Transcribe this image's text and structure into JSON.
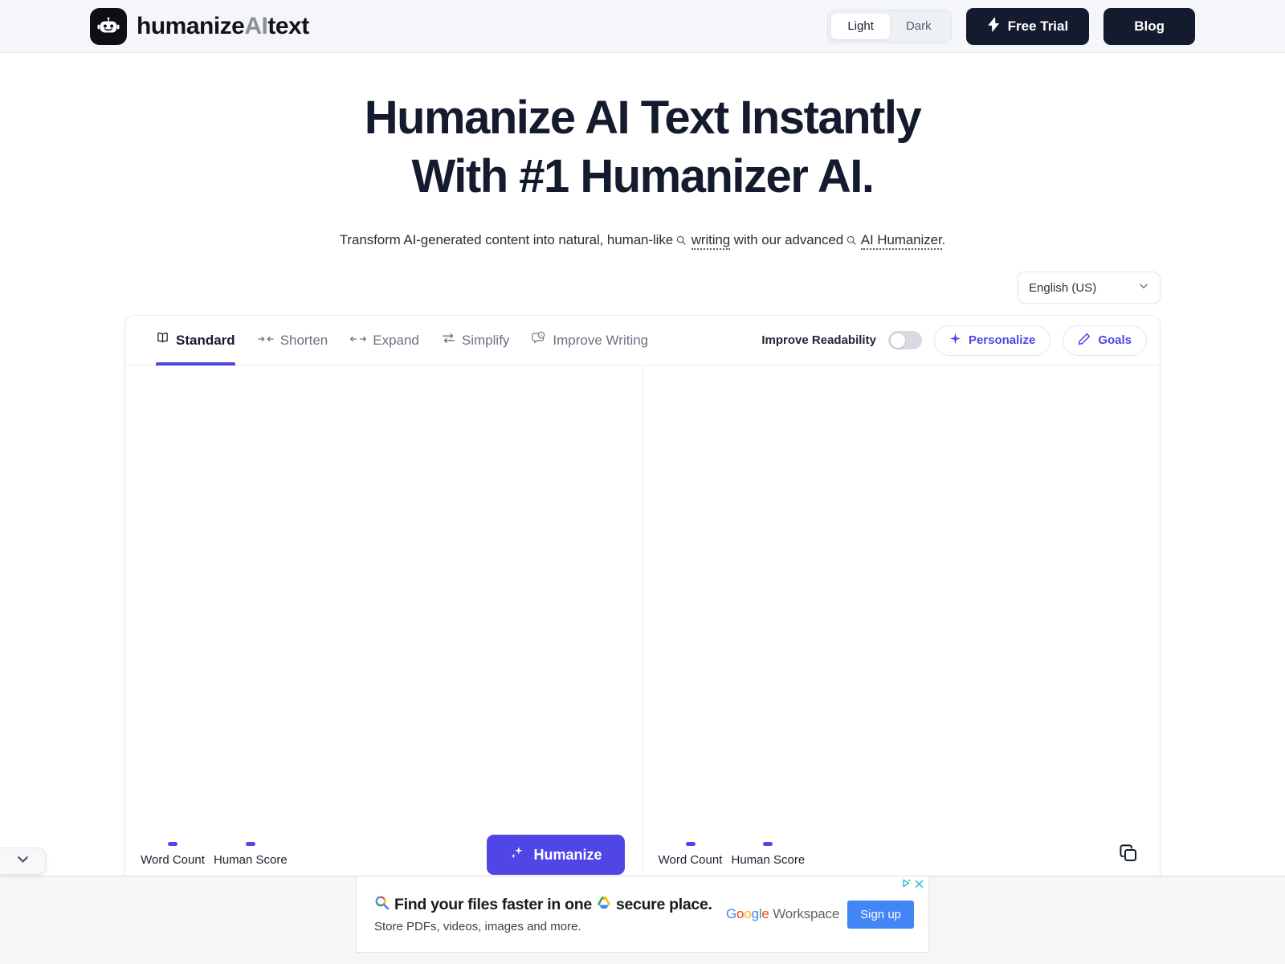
{
  "header": {
    "logo_icon": "robot-icon",
    "brand_part1": "humanize",
    "brand_part2": "AI",
    "brand_part3": "text",
    "theme": {
      "light": "Light",
      "dark": "Dark",
      "active": "Light"
    },
    "free_trial_label": "Free Trial",
    "free_trial_icon": "lightning-bolt-icon",
    "blog_label": "Blog"
  },
  "hero": {
    "title_line1": "Humanize AI Text Instantly",
    "title_line2": "With #1 Humanizer AI.",
    "sub_part1": "Transform AI-generated content into natural, human-like",
    "sub_kw1": "writing",
    "sub_part2": "with our advanced",
    "sub_kw2": "AI Humanizer",
    "sub_part3": "."
  },
  "language": {
    "selected": "English (US)",
    "chevron_icon": "chevron-down-icon"
  },
  "toolbar": {
    "tabs": [
      {
        "label": "Standard",
        "icon": "book-icon",
        "active": true
      },
      {
        "label": "Shorten",
        "icon": "arrows-in-icon",
        "active": false
      },
      {
        "label": "Expand",
        "icon": "arrows-out-icon",
        "active": false
      },
      {
        "label": "Simplify",
        "icon": "swap-vertical-icon",
        "active": false
      },
      {
        "label": "Improve Writing",
        "icon": "speech-bubble-a-icon",
        "active": false
      }
    ],
    "readability_label": "Improve Readability",
    "readability_on": false,
    "personalize_label": "Personalize",
    "personalize_icon": "sparkle-icon",
    "goals_label": "Goals",
    "goals_icon": "pencil-icon"
  },
  "editor": {
    "input_placeholder": "",
    "output_placeholder": "",
    "left_stats": [
      {
        "label": "Word Count",
        "value": "-"
      },
      {
        "label": "Human Score",
        "value": "-"
      }
    ],
    "right_stats": [
      {
        "label": "Word Count",
        "value": "-"
      },
      {
        "label": "Human Score",
        "value": "-"
      }
    ],
    "humanize_label": "Humanize",
    "humanize_icon": "sparkle-icon",
    "copy_icon": "copy-icon"
  },
  "edge_handle": {
    "icon": "chevron-down-icon"
  },
  "ad": {
    "headline_part1": "Find your files faster in one",
    "headline_part2": "secure place.",
    "subline": "Store PDFs, videos, images and more.",
    "brand_g": "G",
    "brand_o1": "o",
    "brand_o2": "o",
    "brand_g2": "g",
    "brand_l": "l",
    "brand_e": "e",
    "brand_suffix": " Workspace",
    "cta_label": "Sign up",
    "search_icon": "google-search-icon",
    "drive_icon": "google-drive-icon",
    "adchoices_icon": "adchoices-icon",
    "close_icon": "close-icon"
  },
  "colors": {
    "accent": "#4f46e5",
    "dark": "#151b2e",
    "header_bg": "#f4f6f9",
    "ad_blue": "#4285f4"
  }
}
